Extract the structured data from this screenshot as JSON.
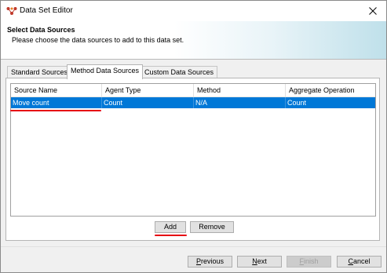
{
  "window": {
    "title": "Data Set Editor",
    "close_icon": "close-icon"
  },
  "banner": {
    "title": "Select Data Sources",
    "description": "Please choose the data sources to add to this data set."
  },
  "tabs": [
    {
      "label": "Standard Sources",
      "active": false
    },
    {
      "label": "Method Data Sources",
      "active": true
    },
    {
      "label": "Custom Data Sources",
      "active": false
    }
  ],
  "table": {
    "columns": [
      "Source Name",
      "Agent Type",
      "Method",
      "Aggregate Operation"
    ],
    "rows": [
      {
        "source_name": "Move count",
        "agent_type": "Count",
        "method": "N/A",
        "aggregate_operation": "Count",
        "selected": true
      }
    ]
  },
  "panel_buttons": {
    "add": "Add",
    "remove": "Remove"
  },
  "footer_buttons": {
    "previous": {
      "prefix": "",
      "mnemonic": "P",
      "rest": "revious"
    },
    "next": {
      "prefix": "",
      "mnemonic": "N",
      "rest": "ext"
    },
    "finish": {
      "prefix": "",
      "mnemonic": "F",
      "rest": "inish",
      "disabled": true
    },
    "cancel": {
      "prefix": "",
      "mnemonic": "C",
      "rest": "ancel"
    }
  },
  "colors": {
    "selection": "#0078d7",
    "annotation_underline": "#e60012"
  }
}
